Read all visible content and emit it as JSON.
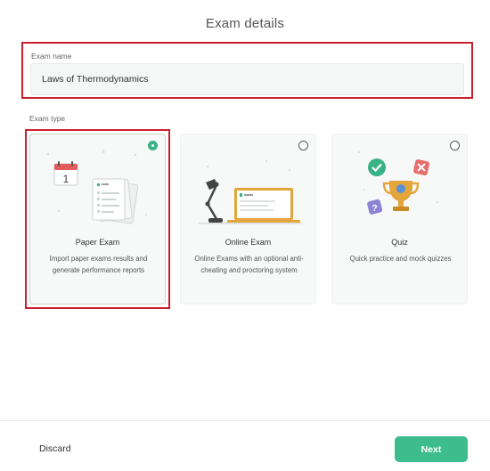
{
  "title": "Exam details",
  "exam_name": {
    "label": "Exam name",
    "value": "Laws of Thermodynamics"
  },
  "exam_type": {
    "label": "Exam type",
    "options": [
      {
        "title": "Paper Exam",
        "description": "Import paper exams results and generate performance reports",
        "selected": true,
        "icon": "calendar-papers-icon"
      },
      {
        "title": "Online Exam",
        "description": "Online Exams with an optional anti-cheating and proctoring system",
        "selected": false,
        "icon": "desk-lamp-laptop-icon"
      },
      {
        "title": "Quiz",
        "description": "Quick practice and mock quizzes",
        "selected": false,
        "icon": "trophy-icon"
      }
    ]
  },
  "calendar_day": "1",
  "footer": {
    "discard_label": "Discard",
    "next_label": "Next"
  },
  "colors": {
    "accent": "#3dbd8d",
    "highlight": "#cc1f2e"
  }
}
